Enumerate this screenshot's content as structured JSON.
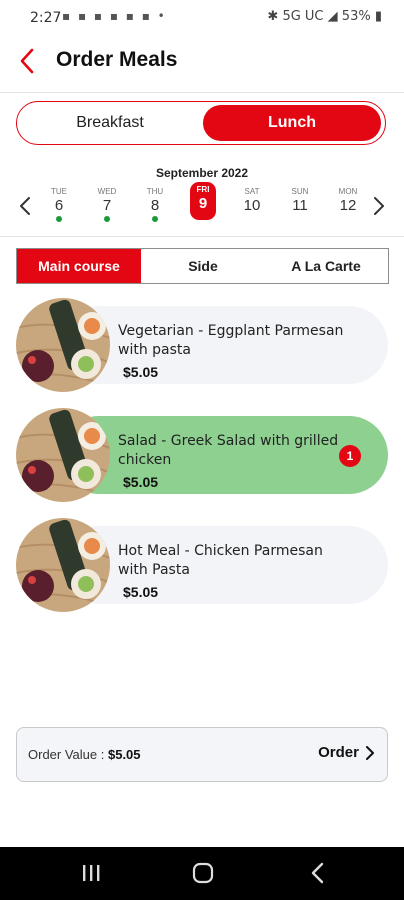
{
  "status_bar": {
    "time": "2:27",
    "network": "5G UC",
    "battery": "53%"
  },
  "header": {
    "title": "Order Meals"
  },
  "meal_toggle": {
    "options": [
      "Breakfast",
      "Lunch"
    ],
    "selected": "Lunch"
  },
  "calendar": {
    "month_label": "September 2022",
    "days": [
      {
        "dow": "TUE",
        "date": "6",
        "has_order": true,
        "selected": false
      },
      {
        "dow": "WED",
        "date": "7",
        "has_order": true,
        "selected": false
      },
      {
        "dow": "THU",
        "date": "8",
        "has_order": true,
        "selected": false
      },
      {
        "dow": "FRI",
        "date": "9",
        "has_order": false,
        "selected": true
      },
      {
        "dow": "SAT",
        "date": "10",
        "has_order": false,
        "selected": false
      },
      {
        "dow": "SUN",
        "date": "11",
        "has_order": false,
        "selected": false
      },
      {
        "dow": "MON",
        "date": "12",
        "has_order": false,
        "selected": false
      }
    ]
  },
  "category_tabs": {
    "items": [
      "Main course",
      "Side",
      "A La Carte"
    ],
    "active": "Main course"
  },
  "meals": [
    {
      "name": "Vegetarian - Eggplant Parmesan with pasta",
      "price": "$5.05",
      "selected": false,
      "quantity": ""
    },
    {
      "name": "Salad - Greek Salad with grilled chicken",
      "price": "$5.05",
      "selected": true,
      "quantity": "1"
    },
    {
      "name": "Hot Meal - Chicken Parmesan with Pasta",
      "price": "$5.05",
      "selected": false,
      "quantity": ""
    }
  ],
  "order_bar": {
    "label": "Order Value :",
    "value": "$5.05",
    "button_label": "Order"
  },
  "colors": {
    "accent": "#e30613",
    "selected_card": "#8dd090",
    "order_dot": "#1a9a3a"
  }
}
